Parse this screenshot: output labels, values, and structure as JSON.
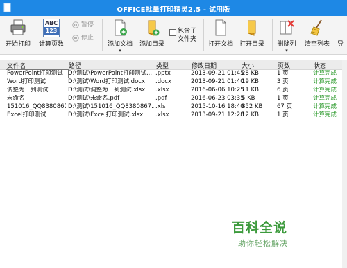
{
  "window": {
    "title": "OFFICE批量打印精灵2.5 - 试用版"
  },
  "toolbar": {
    "start_print": "开始打印",
    "count_pages": "计算页数",
    "count_pages_icon_text": "ABC",
    "count_pages_icon_num": "123",
    "pause": "暂停",
    "stop": "停止",
    "add_document": "添加文档",
    "add_folder": "添加目录",
    "include_subfolders_line1": "包含子",
    "include_subfolders_line2": "文件夹",
    "open_document": "打开文档",
    "open_folder": "打开目录",
    "delete_row": "删除列",
    "clear_list": "清空列表",
    "export_partial": "导"
  },
  "table": {
    "columns": [
      "文件名",
      "路径",
      "类型",
      "修改日期",
      "大小",
      "页数",
      "状态"
    ],
    "rows": [
      {
        "name": "PowerPoint打印测试",
        "path": "D:\\测试\\PowerPoint打印测试...",
        "type": ".pptx",
        "date": "2013-09-21 01:45",
        "size": "28 KB",
        "pages": "1 页",
        "status": "计算完成"
      },
      {
        "name": "Word打印测试",
        "path": "D:\\测试\\Word打印测试.docx",
        "type": ".docx",
        "date": "2013-09-21 01:40",
        "size": "19 KB",
        "pages": "3 页",
        "status": "计算完成"
      },
      {
        "name": "调整为一列测试",
        "path": "D:\\测试\\调整为一列测试.xlsx",
        "type": ".xlsx",
        "date": "2016-06-06 10:25",
        "size": "11 KB",
        "pages": "6 页",
        "status": "计算完成"
      },
      {
        "name": "未命名",
        "path": "D:\\测试\\未命名.pdf",
        "type": ".pdf",
        "date": "2016-06-23 03:35",
        "size": "5 KB",
        "pages": "1 页",
        "status": "计算完成"
      },
      {
        "name": "151016_QQ8380867...",
        "path": "D:\\测试\\151016_QQ8380867...",
        "type": ".xls",
        "date": "2015-10-16 18:40",
        "size": "852 KB",
        "pages": "67 页",
        "status": "计算完成"
      },
      {
        "name": "Excel打印测试",
        "path": "D:\\测试\\Excel打印测试.xlsx",
        "type": ".xlsx",
        "date": "2013-09-21 12:28",
        "size": "12 KB",
        "pages": "1 页",
        "status": "计算完成"
      }
    ]
  },
  "watermark": {
    "brand": "百科全说",
    "tagline": "助你轻松解决"
  },
  "colors": {
    "titlebar": "#1e88e5",
    "status_done": "#2e9b2e"
  }
}
